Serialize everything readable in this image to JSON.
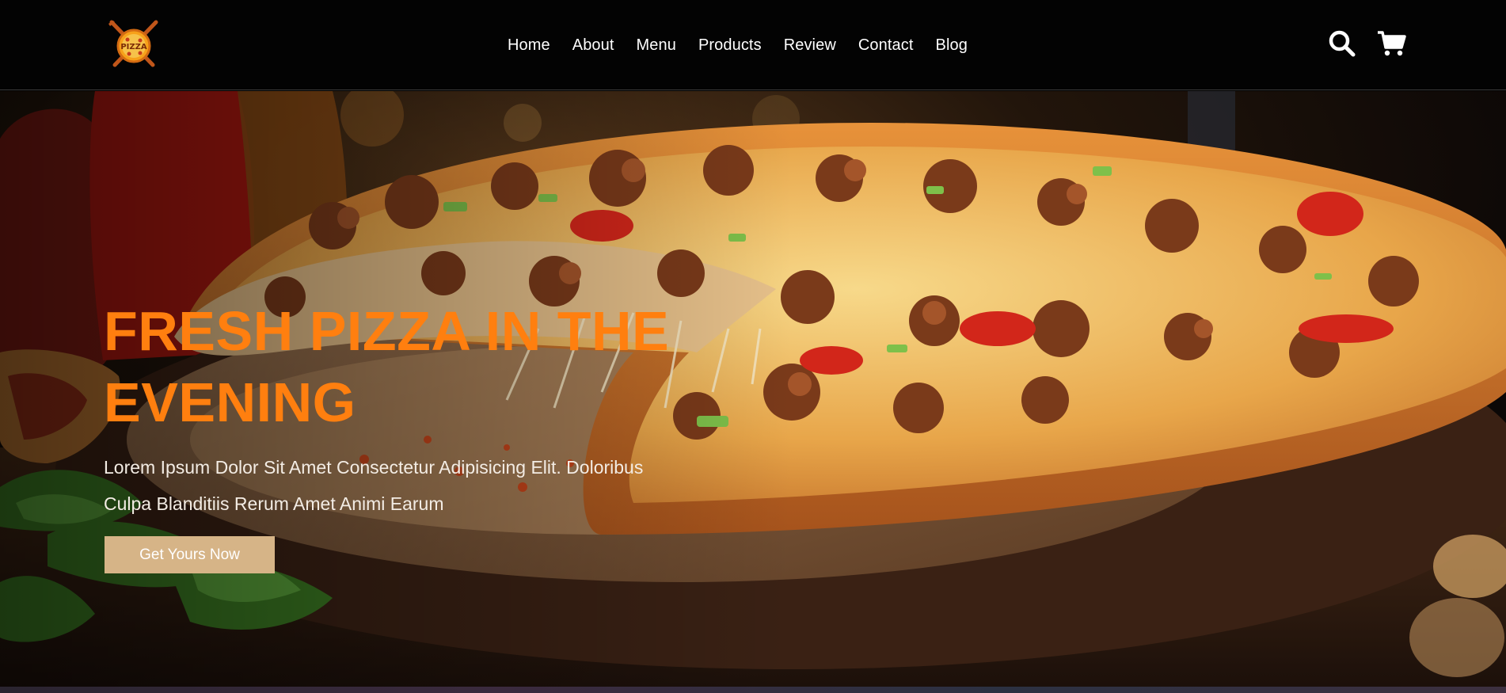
{
  "brand": {
    "logo_text": "PIZZA"
  },
  "nav": {
    "items": [
      {
        "label": "Home"
      },
      {
        "label": "About"
      },
      {
        "label": "Menu"
      },
      {
        "label": "Products"
      },
      {
        "label": "Review"
      },
      {
        "label": "Contact"
      },
      {
        "label": "Blog"
      }
    ]
  },
  "header_icons": [
    "search-icon",
    "cart-icon"
  ],
  "hero": {
    "title_line1": "FRESH PIZZA IN THE",
    "title_line2": "EVENING",
    "description_line1": "Lorem Ipsum Dolor Sit Amet Consectetur Adipisicing Elit. Doloribus",
    "description_line2": "Culpa Blanditiis Rerum Amet Animi Earum",
    "cta_label": "Get Yours Now"
  },
  "colors": {
    "header_bg": "#030303",
    "accent_orange": "#ff7f0f",
    "cta_bg": "#d6b487",
    "text_light": "#ffffff"
  }
}
